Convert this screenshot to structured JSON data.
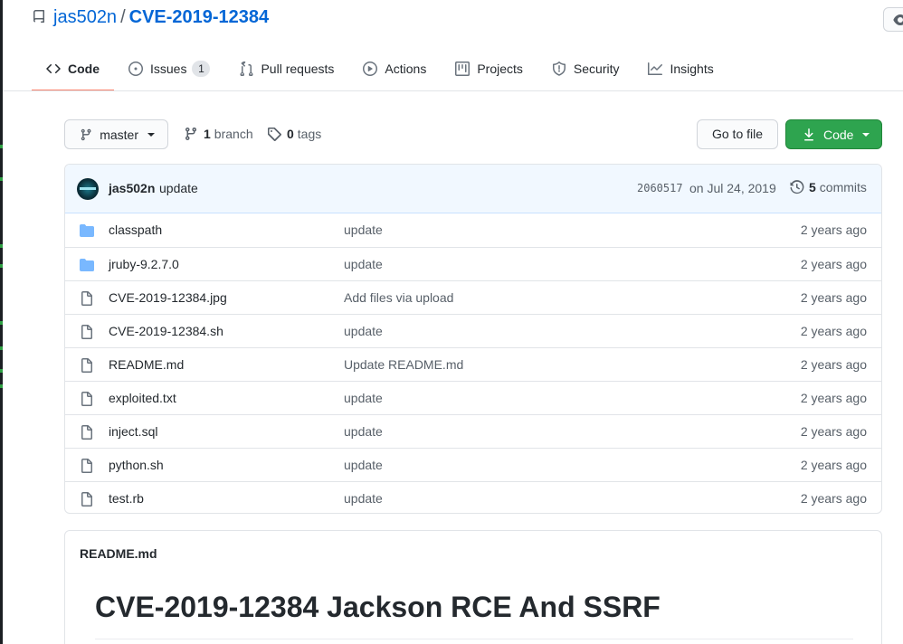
{
  "repo": {
    "owner": "jas502n",
    "separator": "/",
    "name": "CVE-2019-12384"
  },
  "tabs": [
    {
      "label": "Code",
      "icon": "code-icon",
      "active": true
    },
    {
      "label": "Issues",
      "icon": "issue-icon",
      "count": "1"
    },
    {
      "label": "Pull requests",
      "icon": "pull-request-icon"
    },
    {
      "label": "Actions",
      "icon": "play-icon"
    },
    {
      "label": "Projects",
      "icon": "project-icon"
    },
    {
      "label": "Security",
      "icon": "shield-icon"
    },
    {
      "label": "Insights",
      "icon": "graph-icon"
    }
  ],
  "toolbar": {
    "branch": "master",
    "branch_count": "1",
    "branch_label": "branch",
    "tag_count": "0",
    "tag_label": "tags",
    "goto_file": "Go to file",
    "code_button": "Code"
  },
  "commit": {
    "author": "jas502n",
    "message": "update",
    "sha": "2060517",
    "date": "on Jul 24, 2019",
    "commit_count": "5",
    "commit_label": "commits"
  },
  "files": [
    {
      "name": "classpath",
      "type": "folder",
      "message": "update",
      "age": "2 years ago"
    },
    {
      "name": "jruby-9.2.7.0",
      "type": "folder",
      "message": "update",
      "age": "2 years ago"
    },
    {
      "name": "CVE-2019-12384.jpg",
      "type": "file",
      "message": "Add files via upload",
      "age": "2 years ago"
    },
    {
      "name": "CVE-2019-12384.sh",
      "type": "file",
      "message": "update",
      "age": "2 years ago"
    },
    {
      "name": "README.md",
      "type": "file",
      "message": "Update README.md",
      "age": "2 years ago"
    },
    {
      "name": "exploited.txt",
      "type": "file",
      "message": "update",
      "age": "2 years ago"
    },
    {
      "name": "inject.sql",
      "type": "file",
      "message": "update",
      "age": "2 years ago"
    },
    {
      "name": "python.sh",
      "type": "file",
      "message": "update",
      "age": "2 years ago"
    },
    {
      "name": "test.rb",
      "type": "file",
      "message": "update",
      "age": "2 years ago"
    }
  ],
  "readme": {
    "title": "README.md",
    "heading": "CVE-2019-12384 Jackson RCE And SSRF"
  },
  "colors": {
    "link": "#0366d6",
    "primary_button": "#2ea44f",
    "active_tab_underline": "#f9826c",
    "folder": "#79b8ff"
  }
}
